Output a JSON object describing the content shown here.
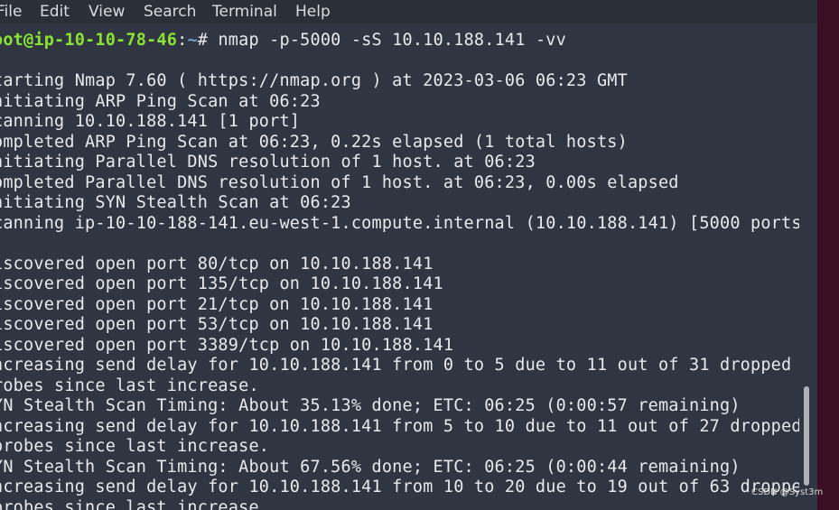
{
  "menubar": {
    "items": [
      "File",
      "Edit",
      "View",
      "Search",
      "Terminal",
      "Help"
    ]
  },
  "terminal": {
    "prompt": {
      "user_host": "oot@ip-10-10-78-46",
      "separator": ":",
      "path": "~",
      "symbol": "# ",
      "command": "nmap -p-5000 -sS 10.10.188.141 -vv"
    },
    "lines": [
      "",
      "tarting Nmap 7.60 ( https://nmap.org ) at 2023-03-06 06:23 GMT",
      "nitiating ARP Ping Scan at 06:23",
      "canning 10.10.188.141 [1 port]",
      "ompleted ARP Ping Scan at 06:23, 0.22s elapsed (1 total hosts)",
      "nitiating Parallel DNS resolution of 1 host. at 06:23",
      "ompleted Parallel DNS resolution of 1 host. at 06:23, 0.00s elapsed",
      "nitiating SYN Stealth Scan at 06:23",
      "canning ip-10-10-188-141.eu-west-1.compute.internal (10.10.188.141) [5000 ports",
      "",
      "iscovered open port 80/tcp on 10.10.188.141",
      "iscovered open port 135/tcp on 10.10.188.141",
      "iscovered open port 21/tcp on 10.10.188.141",
      "iscovered open port 53/tcp on 10.10.188.141",
      "iscovered open port 3389/tcp on 10.10.188.141",
      "ncreasing send delay for 10.10.188.141 from 0 to 5 due to 11 out of 31 dropped",
      "robes since last increase.",
      "YN Stealth Scan Timing: About 35.13% done; ETC: 06:25 (0:00:57 remaining)",
      "ncreasing send delay for 10.10.188.141 from 5 to 10 due to 11 out of 27 dropped",
      "probes since last increase.",
      "YN Stealth Scan Timing: About 67.56% done; ETC: 06:25 (0:00:44 remaining)",
      "ncreasing send delay for 10.10.188.141 from 10 to 20 due to 19 out of 63 droppe",
      "probes since last increase"
    ]
  },
  "watermark": "CSDN @Syst3m",
  "colors": {
    "terminal_bg": "#303641",
    "text": "#e8e9ec",
    "prompt_user": "#8ae234",
    "prompt_path": "#729fcf",
    "desktop_edge": "#3a0f26"
  }
}
